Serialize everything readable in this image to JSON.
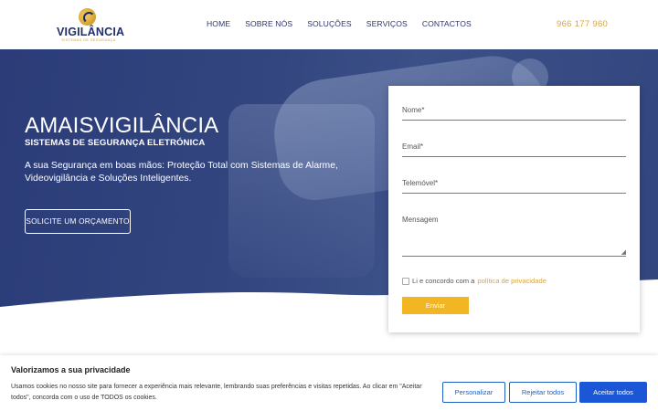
{
  "brand": {
    "name": "VIGILÂNCIA",
    "tagline": "SISTEMAS DE SEGURANÇA"
  },
  "nav": {
    "items": [
      "HOME",
      "SOBRE NÓS",
      "SOLUÇÕES",
      "SERVIÇOS",
      "CONTACTOS"
    ]
  },
  "header": {
    "phone": "966 177 960"
  },
  "hero": {
    "title": "AMAISVIGILÂNCIA",
    "subtitle": "SISTEMAS DE SEGURANÇA ELETRÓNICA",
    "text": "A sua Segurança em boas mãos: Proteção Total com Sistemas de Alarme, Videovigilância e Soluções Inteligentes.",
    "cta_label": "SOLICITE UM ORÇAMENTO"
  },
  "form": {
    "name_label": "Nome*",
    "email_label": "Email*",
    "phone_label": "Telemóvel*",
    "message_label": "Mensagem",
    "consent_text": "Li e concordo com a",
    "consent_link": "política de privacidade",
    "submit_label": "Enviar"
  },
  "cookie": {
    "title": "Valorizamos a sua privacidade",
    "text": "Usamos cookies no nosso site para fornecer a experiência mais relevante, lembrando suas preferências e visitas repetidas. Ao clicar em \"Aceitar todos\", concorda com o uso de TODOS os cookies.",
    "customize_label": "Personalizar",
    "reject_label": "Rejeitar todos",
    "accept_label": "Aceitar todos"
  },
  "colors": {
    "navy": "#2b3674",
    "gold": "#d9a53a",
    "submit": "#f2b523",
    "accept": "#1a56d6"
  }
}
